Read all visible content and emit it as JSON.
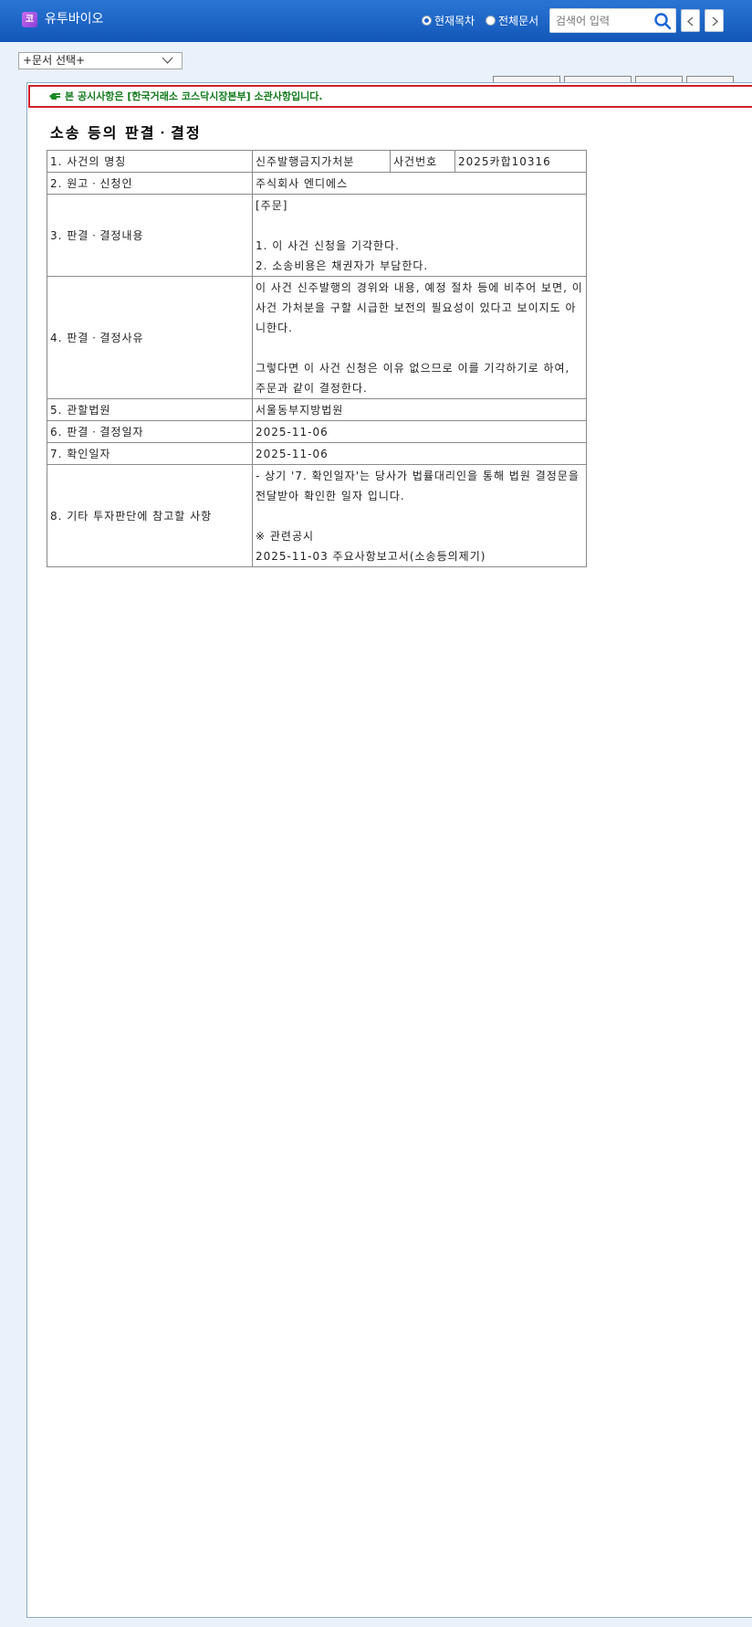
{
  "header": {
    "logo_char": "코",
    "company_name": "유투바이오",
    "radio_current": "현재목차",
    "radio_all": "전체문서",
    "search_placeholder": "검색어 입력",
    "selected_radio": "current"
  },
  "toolbar": {
    "doc_select": "+문서 선택+"
  },
  "notice": {
    "text": "본 공시사항은 [한국거래소 코스닥시장본부] 소관사항입니다."
  },
  "document": {
    "title": "소송 등의 판결ㆍ결정",
    "rows": {
      "r1_label": "1. 사건의 명칭",
      "r1_value": "신주발행금지가처분",
      "r1_label2": "사건번호",
      "r1_value2": "2025카합10316",
      "r2_label": "2. 원고ㆍ신청인",
      "r2_value": "주식회사 엔디에스",
      "r3_label": "3. 판결ㆍ결정내용",
      "r3_value": "[주문]\n\n1. 이 사건 신청을 기각한다.\n2. 소송비용은 채권자가 부담한다.",
      "r4_label": "4. 판결ㆍ결정사유",
      "r4_value": "이 사건 신주발행의 경위와 내용, 예정 절차 등에 비추어 보면, 이 사건 가처분을 구할 시급한 보전의 필요성이 있다고 보이지도 아니한다.\n\n그렇다면 이 사건 신청은 이유 없으므로 이를 기각하기로 하여, 주문과 같이 결정한다.",
      "r5_label": "5. 관할법원",
      "r5_value": "서울동부지방법원",
      "r6_label": "6. 판결ㆍ결정일자",
      "r6_value": "2025-11-06",
      "r7_label": "7. 확인일자",
      "r7_value": "2025-11-06",
      "r8_label": "8. 기타 투자판단에 참고할 사항",
      "r8_value": "- 상기 '7. 확인일자'는 당사가 법률대리인을 통해 법원 결정문을 전달받아 확인한 일자 입니다.\n\n※ 관련공시\n2025-11-03 주요사항보고서(소송등의제기)"
    }
  }
}
